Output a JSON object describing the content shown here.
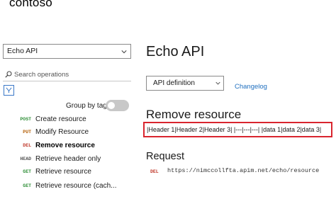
{
  "brand": {
    "logo_text": "contoso"
  },
  "sidebar": {
    "api_select": {
      "value": "Echo API"
    },
    "search": {
      "placeholder": "Search operations"
    },
    "group_by_tag": {
      "label": "Group by tag",
      "enabled": false
    },
    "operations": [
      {
        "verb": "POST",
        "name": "Create resource",
        "active": false
      },
      {
        "verb": "PUT",
        "name": "Modify Resource",
        "active": false
      },
      {
        "verb": "DEL",
        "name": "Remove resource",
        "active": true
      },
      {
        "verb": "HEAD",
        "name": "Retrieve header only",
        "active": false
      },
      {
        "verb": "GET",
        "name": "Retrieve resource",
        "active": false
      },
      {
        "verb": "GET",
        "name": "Retrieve resource (cach...",
        "active": false
      }
    ]
  },
  "main": {
    "title": "Echo API",
    "definition_select": {
      "value": "API definition"
    },
    "changelog_label": "Changelog",
    "operation_title": "Remove resource",
    "description": "|Header 1|Header 2|Header 3| |---|---|---| |data 1|data 2|data 3|",
    "request": {
      "heading": "Request",
      "verb": "DEL",
      "url": "https://nimccollfta.apim.net/echo/resource"
    }
  },
  "colors": {
    "highlight_border": "#d9252e",
    "link": "#1f6fbf",
    "verb_post": "#2f8f38",
    "verb_put": "#b45f06",
    "verb_del": "#c0392b",
    "verb_get": "#2f8f38"
  }
}
